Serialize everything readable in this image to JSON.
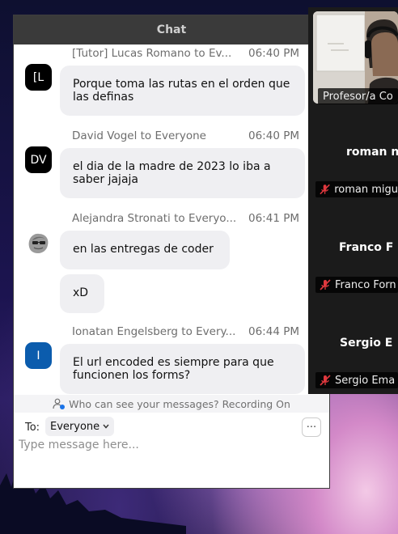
{
  "chat": {
    "title": "Chat",
    "minimize_label": "–",
    "messages": [
      {
        "sender": "[Tutor] Lucas Romano to Ev...",
        "time": "06:40 PM",
        "avatar": "[L",
        "bubbles": [
          "Porque toma las rutas en el orden que las definas"
        ]
      },
      {
        "sender": "David Vogel to Everyone",
        "time": "06:40 PM",
        "avatar": "DV",
        "bubbles": [
          "el dia de la madre de 2023 lo iba a saber jajaja"
        ]
      },
      {
        "sender": "Alejandra Stronati to Everyo...",
        "time": "06:41 PM",
        "avatar": "",
        "bubbles": [
          "en las entregas de coder",
          "xD"
        ]
      },
      {
        "sender": "Ionatan Engelsberg to Every...",
        "time": "06:44 PM",
        "avatar": "I",
        "bubbles": [
          "El url encoded es siempre para que funcionen los forms?"
        ]
      }
    ],
    "privacy_notice": "Who can see your messages? Recording On",
    "compose": {
      "to_label": "To:",
      "recipient": "Everyone",
      "more_label": "···",
      "placeholder": "Type message here..."
    }
  },
  "video_panel": {
    "tiles": [
      {
        "name_tag": "Profesor/a Co"
      },
      {
        "display_name": "roman n",
        "name_tag": "roman migu"
      },
      {
        "display_name": "Franco F",
        "name_tag": "Franco Forn"
      },
      {
        "display_name": "Sergio E",
        "name_tag": "Sergio Ema"
      }
    ]
  },
  "colors": {
    "titlebar": "#3a3a3a",
    "bubble": "#efeff2",
    "avatar_black": "#000000",
    "avatar_blue": "#0b5cad",
    "mute_red": "#e0383e",
    "video_bg": "#1b1b1b"
  },
  "icons": {
    "privacy": "person-lock-icon",
    "dropdown": "chevron-down-icon",
    "mute": "microphone-muted-icon"
  }
}
